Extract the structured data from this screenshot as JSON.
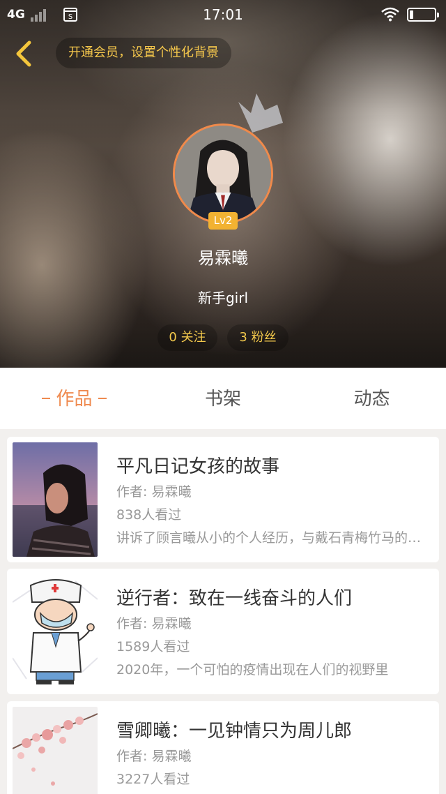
{
  "status_bar": {
    "network": "4G",
    "time": "17:01",
    "icons": [
      "signal-icon",
      "sim-icon",
      "wifi-icon",
      "battery-icon"
    ]
  },
  "header": {
    "vip_banner": "开通会员，设置个性化背景",
    "level": "Lv2",
    "username": "易霖曦",
    "title": "新手girl",
    "following": "0 关注",
    "fans": "3 粉丝"
  },
  "tabs": [
    {
      "label": "作品",
      "active": true
    },
    {
      "label": "书架",
      "active": false
    },
    {
      "label": "动态",
      "active": false
    }
  ],
  "works": [
    {
      "title": "平凡日记女孩的故事",
      "author": "作者: 易霖曦",
      "views": "838人看过",
      "desc": "讲诉了顾言曦从小的个人经历，与戴石青梅竹马的故事"
    },
    {
      "title": "逆行者：致在一线奋斗的人们",
      "author": "作者: 易霖曦",
      "views": "1589人看过",
      "desc": "2020年，一个可怕的疫情出现在人们的视野里"
    },
    {
      "title": "雪卿曦：一见钟情只为周儿郎",
      "author": "作者: 易霖曦",
      "views": "3227人看过",
      "desc": ""
    }
  ],
  "colors": {
    "accent": "#ef8a4f",
    "gold": "#f3c94c",
    "badge": "#f2b232"
  }
}
